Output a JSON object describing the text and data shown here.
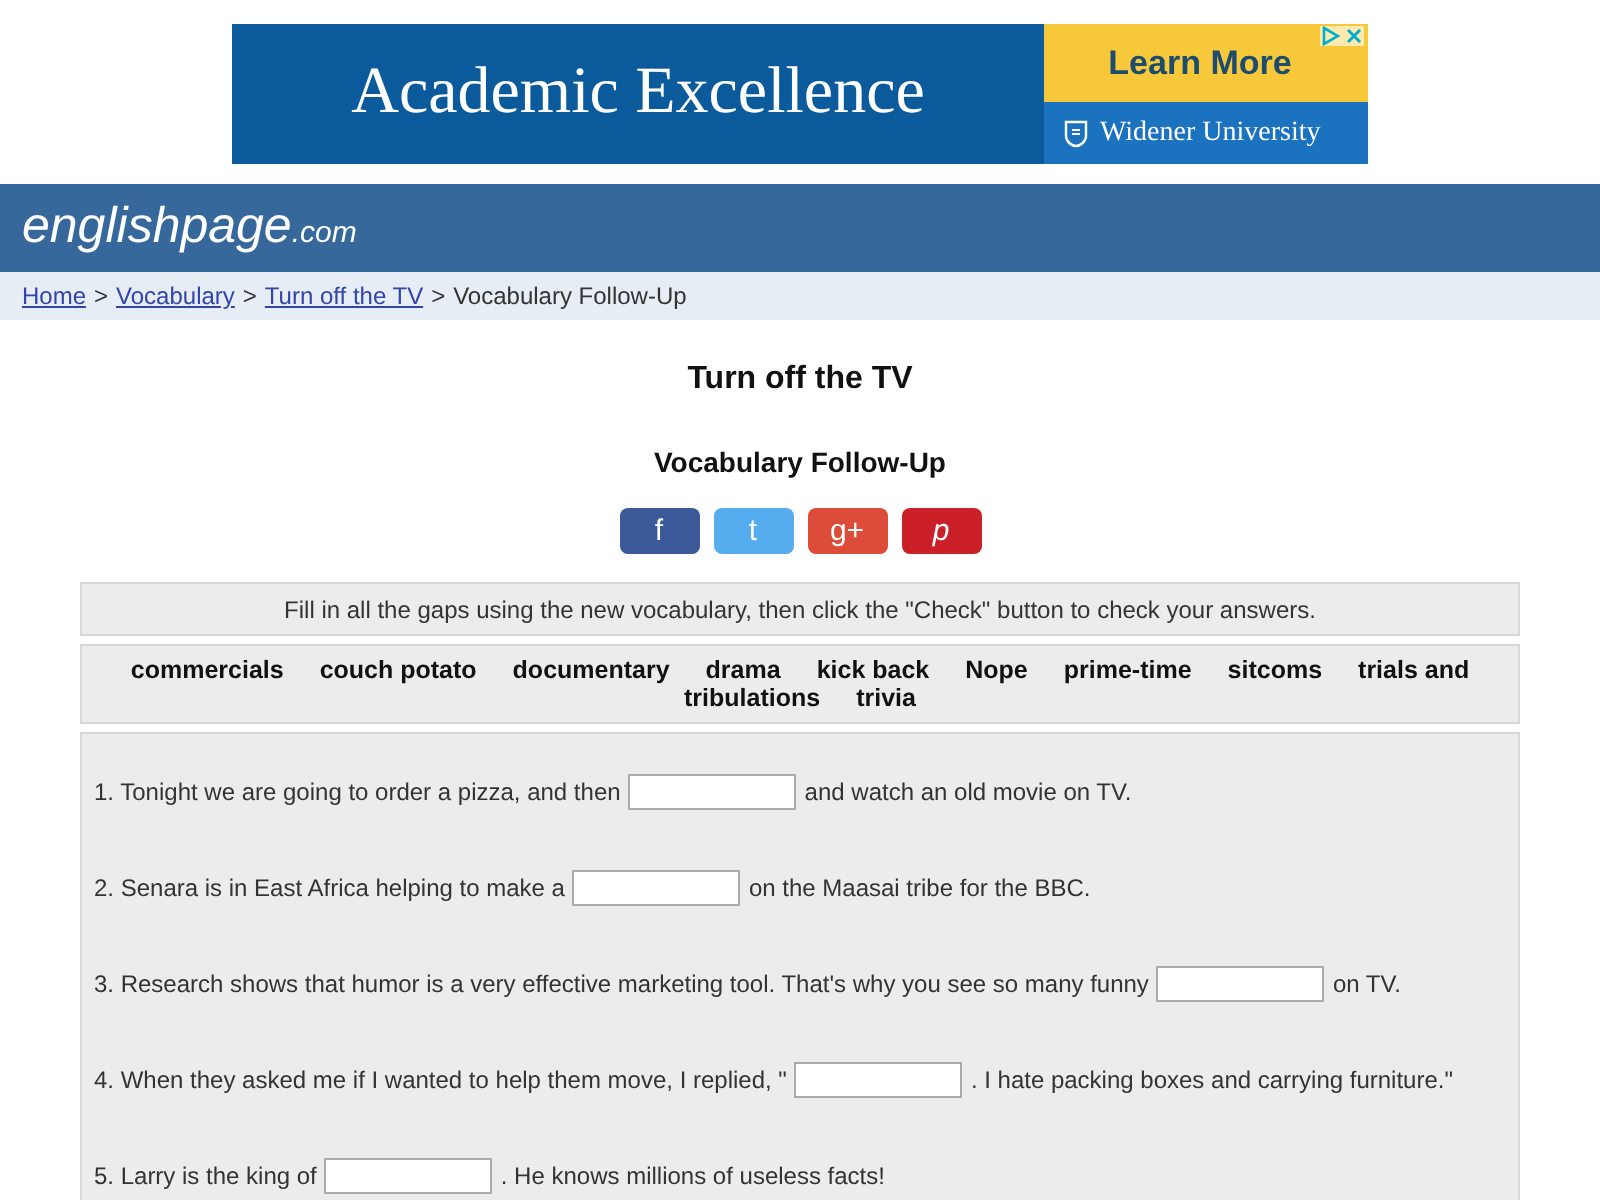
{
  "ad": {
    "headline": "Academic Excellence",
    "cta": "Learn More",
    "sponsor": "Widener University"
  },
  "site": {
    "logo": "englishpage",
    "logo_suffix": ".com"
  },
  "breadcrumb": {
    "links": [
      "Home",
      "Vocabulary",
      "Turn off the TV"
    ],
    "separator": ">",
    "current": "Vocabulary Follow-Up"
  },
  "title": "Turn off the TV",
  "subtitle": "Vocabulary Follow-Up",
  "share_buttons": [
    {
      "label": "f",
      "color": "#3b5998"
    },
    {
      "label": "t",
      "color": "#55acee"
    },
    {
      "label": "g+",
      "color": "#dd4b39"
    },
    {
      "label": "p",
      "color": "#cb2027"
    }
  ],
  "instructions": "Fill in all the gaps using the new vocabulary, then click the \"Check\" button to check your answers.",
  "word_bank": [
    [
      "commercials",
      "couch potato",
      "documentary",
      "drama",
      "kick back",
      "Nope",
      "prime-time",
      "sitcoms",
      "trials and"
    ],
    [
      "tribulations",
      "trivia"
    ]
  ],
  "questions": [
    {
      "before": "1. Tonight we are going to order a pizza, and then",
      "after": "and watch an old movie on TV."
    },
    {
      "before": "2. Senara is in East Africa helping to make a",
      "after": "on the Maasai tribe for the BBC."
    },
    {
      "before": "3. Research shows that humor is a very effective marketing tool. That's why you see so many funny",
      "after": "on TV."
    },
    {
      "before": "4. When they asked me if I wanted to help them move, I replied, \"",
      "after": ". I hate packing boxes and carrying furniture.\""
    },
    {
      "before": "5. Larry is the king of",
      "after": ". He knows millions of useless facts!"
    }
  ]
}
